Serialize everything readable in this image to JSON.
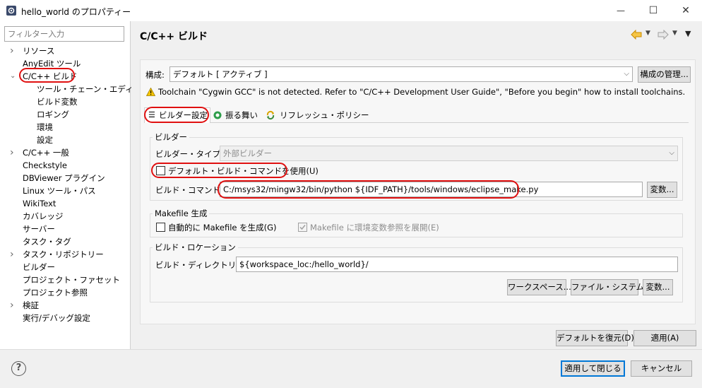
{
  "window": {
    "title": "hello_world のプロパティー",
    "minimize_glyph": "—",
    "maximize_glyph": "☐",
    "close_glyph": "✕"
  },
  "filter": {
    "placeholder": "フィルター入力"
  },
  "tree": {
    "items": [
      {
        "label": "リソース",
        "has_arrow": true
      },
      {
        "label": "AnyEdit ツール",
        "has_arrow": false
      },
      {
        "label": "C/C++ ビルド",
        "has_arrow": true,
        "expanded": true
      },
      {
        "label": "ツール・チェーン・エディター",
        "child": true
      },
      {
        "label": "ビルド変数",
        "child": true
      },
      {
        "label": "ロギング",
        "child": true
      },
      {
        "label": "環境",
        "child": true
      },
      {
        "label": "設定",
        "child": true
      },
      {
        "label": "C/C++ 一般",
        "has_arrow": true
      },
      {
        "label": "Checkstyle"
      },
      {
        "label": "DBViewer プラグイン"
      },
      {
        "label": "Linux ツール・パス"
      },
      {
        "label": "WikiText"
      },
      {
        "label": "カバレッジ"
      },
      {
        "label": "サーバー"
      },
      {
        "label": "タスク・タグ"
      },
      {
        "label": "タスク・リポジトリー",
        "has_arrow": true
      },
      {
        "label": "ビルダー"
      },
      {
        "label": "プロジェクト・ファセット"
      },
      {
        "label": "プロジェクト参照"
      },
      {
        "label": "検証",
        "has_arrow": true
      },
      {
        "label": "実行/デバッグ設定"
      }
    ]
  },
  "page": {
    "title": "C/C++ ビルド",
    "config_label": "構成:",
    "config_value": "デフォルト [ アクティブ ]",
    "manage_button": "構成の管理...",
    "warning": "Toolchain \"Cygwin GCC\" is not detected. Refer to \"C/C++ Development User Guide\", \"Before you begin\" how to install toolchains.",
    "tabs": [
      {
        "label": "ビルダー設定",
        "icon": "builder-settings-icon",
        "active": true
      },
      {
        "label": "振る舞い",
        "icon": "behavior-icon"
      },
      {
        "label": "リフレッシュ・ポリシー",
        "icon": "refresh-policy-icon"
      }
    ],
    "builder_group": {
      "title": "ビルダー",
      "type_label": "ビルダー・タイプ(T):",
      "type_value": "外部ビルダー",
      "default_cmd_label": "デフォルト・ビルド・コマンドを使用(U)",
      "default_cmd_checked": false,
      "cmd_label": "ビルド・コマンド(C):",
      "cmd_value": "C:/msys32/mingw32/bin/python ${IDF_PATH}/tools/windows/eclipse_make.py",
      "vars_button": "変数..."
    },
    "makefile_group": {
      "title": "Makefile 生成",
      "auto_label": "自動的に Makefile を生成(G)",
      "auto_checked": false,
      "expand_label": "Makefile に環境変数参照を展開(E)",
      "expand_checked": true
    },
    "location_group": {
      "title": "ビルド・ロケーション",
      "dir_label": "ビルド・ディレクトリー(D):",
      "dir_value": "${workspace_loc:/hello_world}/",
      "workspace_button": "ワークスペース...",
      "filesystem_button": "ファイル・システム...",
      "vars_button": "変数..."
    },
    "restore_button": "デフォルトを復元(D)",
    "apply_button": "適用(A)"
  },
  "bottom": {
    "help_glyph": "?",
    "apply_close_button": "適用して閉じる",
    "cancel_button": "キャンセル"
  },
  "colors": {
    "highlight_ring": "#e01010",
    "accent": "#0078d7",
    "warning": "#f5c400",
    "back_arrow": "#e8a400"
  }
}
